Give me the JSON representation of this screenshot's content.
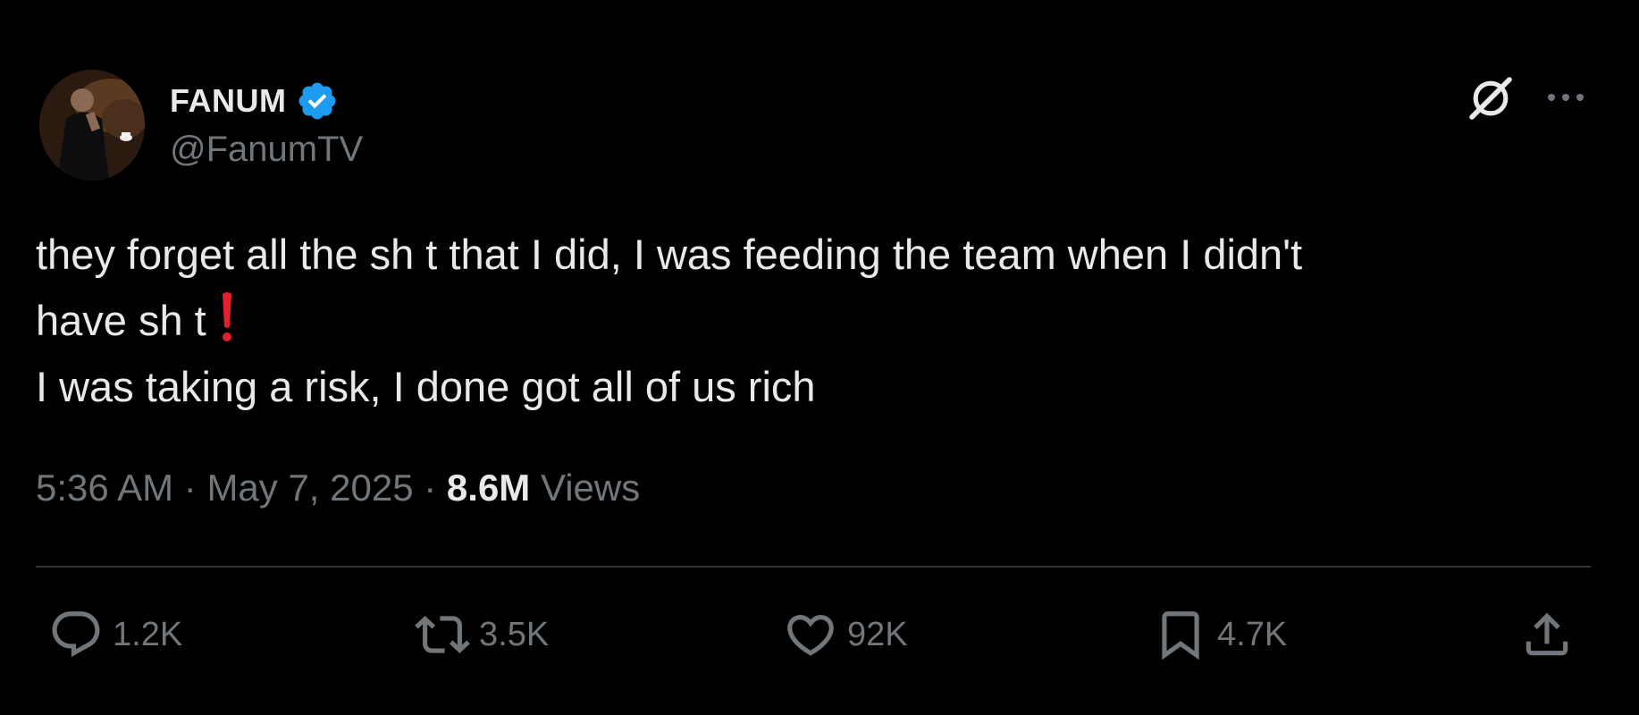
{
  "author": {
    "display_name": "FANUM",
    "handle": "@FanumTV",
    "verified": true,
    "verified_color": "#1d9bf0",
    "avatar_icon": "profile-photo"
  },
  "header_actions": {
    "grok_icon": "grok-icon",
    "more_icon": "more-icon"
  },
  "tweet": {
    "lines": [
      "they forget all the sh t that I did, I was feeding the team when I didn't",
      "have sh t",
      "I was taking a risk, I done got all of us rich"
    ],
    "emoji": "red-exclamation-mark",
    "emoji_color": "#e5202e"
  },
  "meta": {
    "time": "5:36 AM",
    "separator_1": " · ",
    "date": "May 7, 2025",
    "separator_2": " · ",
    "views_count": "8.6M",
    "views_label": " Views"
  },
  "actions": {
    "reply_count": "1.2K",
    "retweet_count": "3.5K",
    "like_count": "92K",
    "bookmark_count": "4.7K",
    "share_icon": "share-icon"
  },
  "colors": {
    "background": "#000000",
    "text_primary": "#e7e9ea",
    "text_secondary": "#71767b",
    "divider": "#2f3336"
  }
}
